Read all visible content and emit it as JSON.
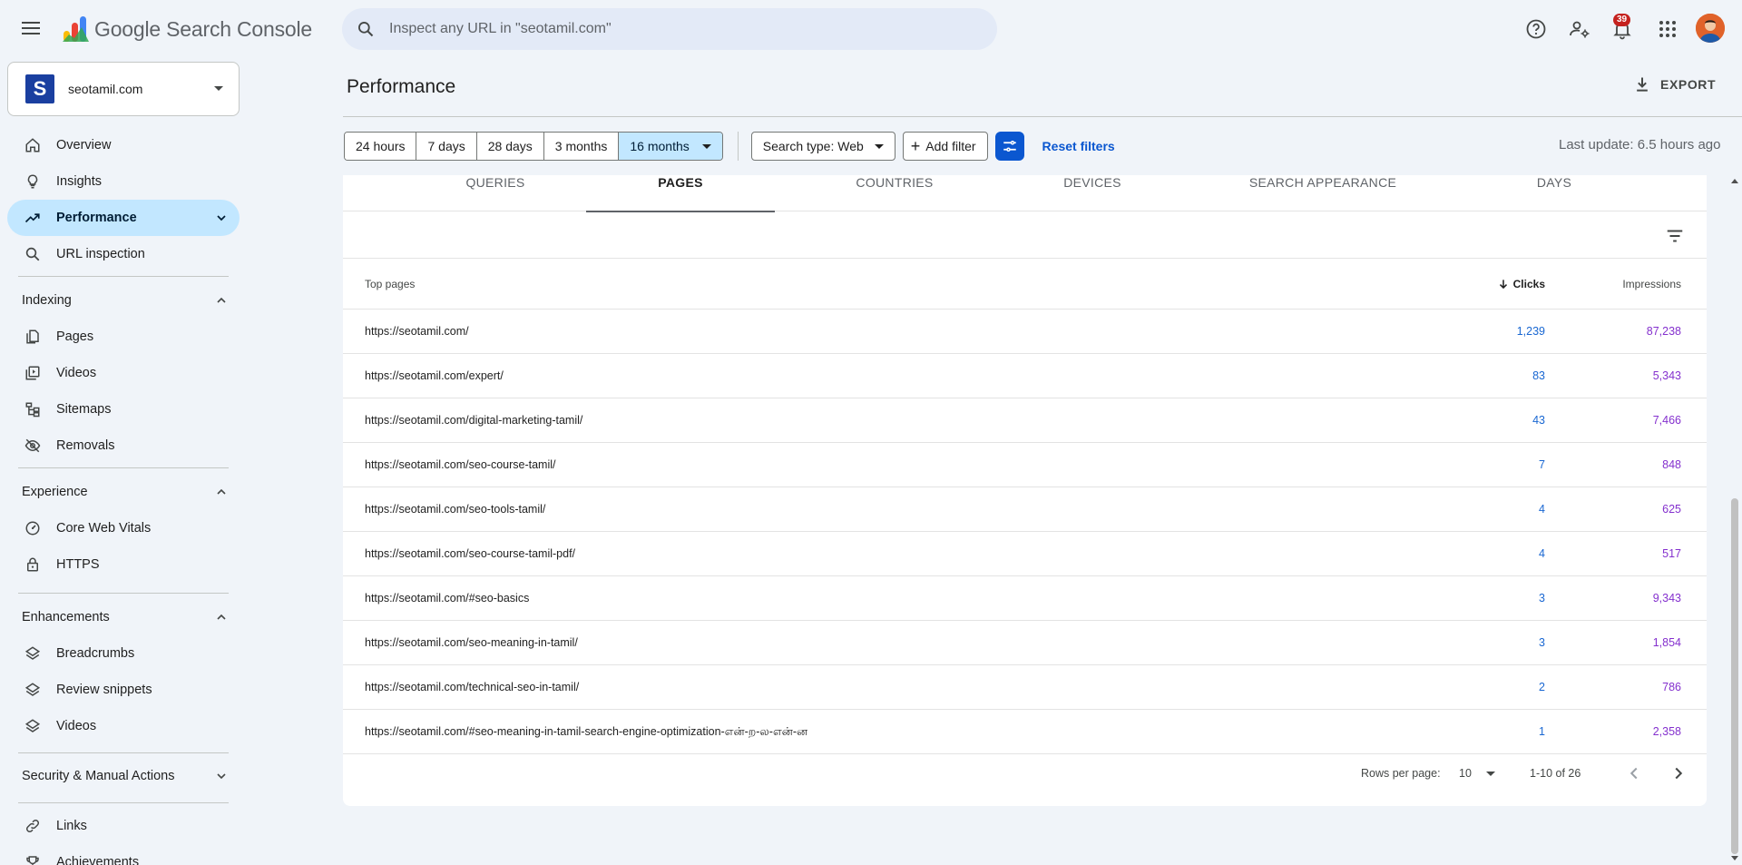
{
  "app": {
    "brand": "Google Search Console"
  },
  "search": {
    "placeholder": "Inspect any URL in \"seotamil.com\""
  },
  "header": {
    "notifications_count": "39"
  },
  "property": {
    "icon_letter": "S",
    "name": "seotamil.com"
  },
  "sidebar": {
    "overview": "Overview",
    "insights": "Insights",
    "performance": "Performance",
    "url_inspection": "URL inspection",
    "indexing": {
      "title": "Indexing",
      "items": [
        "Pages",
        "Videos",
        "Sitemaps",
        "Removals"
      ]
    },
    "experience": {
      "title": "Experience",
      "items": [
        "Core Web Vitals",
        "HTTPS"
      ]
    },
    "enhancements": {
      "title": "Enhancements",
      "items": [
        "Breadcrumbs",
        "Review snippets",
        "Videos"
      ]
    },
    "security": {
      "title": "Security & Manual Actions"
    },
    "links": "Links",
    "achievements": "Achievements"
  },
  "page": {
    "title": "Performance",
    "export_label": "EXPORT"
  },
  "filters": {
    "ranges": [
      "24 hours",
      "7 days",
      "28 days",
      "3 months",
      "16 months"
    ],
    "selected_range": "16 months",
    "search_type": "Search type: Web",
    "add_filter": "Add filter",
    "reset": "Reset filters",
    "last_update": "Last update: 6.5 hours ago"
  },
  "tabs": [
    "QUERIES",
    "PAGES",
    "COUNTRIES",
    "DEVICES",
    "SEARCH APPEARANCE",
    "DAYS"
  ],
  "active_tab": "PAGES",
  "table": {
    "headers": {
      "page": "Top pages",
      "clicks": "Clicks",
      "impressions": "Impressions"
    },
    "rows": [
      {
        "url": "https://seotamil.com/",
        "clicks": "1,239",
        "impressions": "87,238"
      },
      {
        "url": "https://seotamil.com/expert/",
        "clicks": "83",
        "impressions": "5,343"
      },
      {
        "url": "https://seotamil.com/digital-marketing-tamil/",
        "clicks": "43",
        "impressions": "7,466"
      },
      {
        "url": "https://seotamil.com/seo-course-tamil/",
        "clicks": "7",
        "impressions": "848"
      },
      {
        "url": "https://seotamil.com/seo-tools-tamil/",
        "clicks": "4",
        "impressions": "625"
      },
      {
        "url": "https://seotamil.com/seo-course-tamil-pdf/",
        "clicks": "4",
        "impressions": "517"
      },
      {
        "url": "https://seotamil.com/#seo-basics",
        "clicks": "3",
        "impressions": "9,343"
      },
      {
        "url": "https://seotamil.com/seo-meaning-in-tamil/",
        "clicks": "3",
        "impressions": "1,854"
      },
      {
        "url": "https://seotamil.com/technical-seo-in-tamil/",
        "clicks": "2",
        "impressions": "786"
      },
      {
        "url": "https://seotamil.com/#seo-meaning-in-tamil-search-engine-optimization-என்-ற-ல-என்-ன",
        "clicks": "1",
        "impressions": "2,358"
      }
    ]
  },
  "pagination": {
    "rows_label": "Rows per page:",
    "rows_value": "10",
    "range": "1-10 of 26"
  },
  "colors": {
    "accent": "#0b57d0",
    "active_nav": "#c2e7ff",
    "clicks": "#1967d2",
    "impressions": "#8430ce"
  }
}
